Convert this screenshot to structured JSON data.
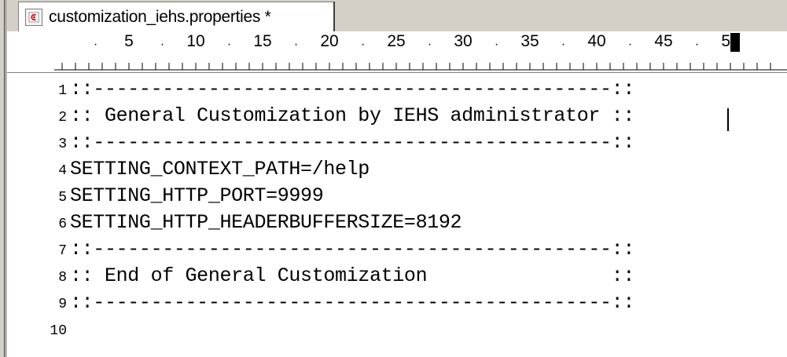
{
  "tab": {
    "title": "customization_iehs.properties *",
    "icon": "properties-file-icon"
  },
  "ruler": {
    "labels": [
      "5",
      "10",
      "15",
      "20",
      "25",
      "30",
      "35",
      "40",
      "45",
      "50"
    ]
  },
  "editor": {
    "lines": [
      {
        "number": "1",
        "text": "::---------------------------------------------::"
      },
      {
        "number": "2",
        "text": ":: General Customization by IEHS administrator ::"
      },
      {
        "number": "3",
        "text": "::---------------------------------------------::"
      },
      {
        "number": "4",
        "text": "SETTING_CONTEXT_PATH=/help"
      },
      {
        "number": "5",
        "text": "SETTING_HTTP_PORT=9999"
      },
      {
        "number": "6",
        "text": "SETTING_HTTP_HEADERBUFFERSIZE=8192"
      },
      {
        "number": "7",
        "text": "::---------------------------------------------::"
      },
      {
        "number": "8",
        "text": ":: End of General Customization                ::"
      },
      {
        "number": "9",
        "text": "::---------------------------------------------::"
      },
      {
        "number": "10",
        "text": ""
      }
    ]
  }
}
